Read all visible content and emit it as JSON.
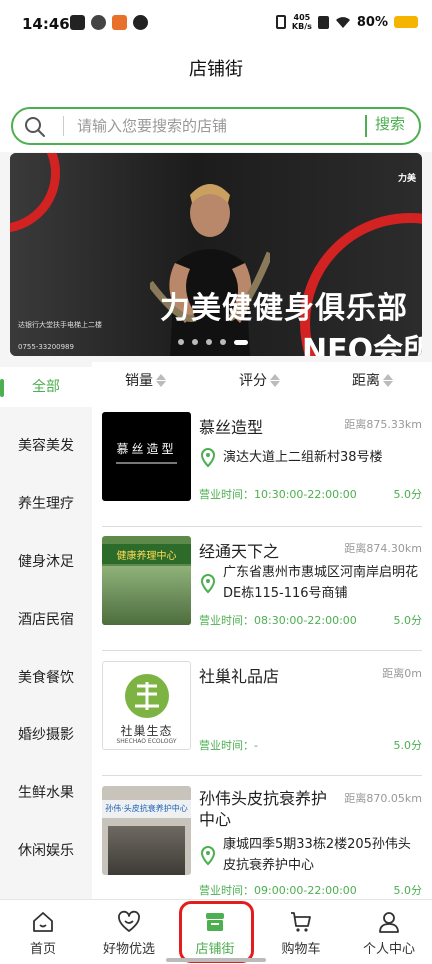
{
  "status_bar": {
    "time": "14:46",
    "speed_value": "405",
    "speed_unit": "KB/s",
    "battery": "80%"
  },
  "header": {
    "title": "店铺街"
  },
  "search": {
    "placeholder": "请输入您要搜索的店铺",
    "button_label": "搜索"
  },
  "banner": {
    "logo_text": "力美",
    "headline": "力美健健身俱乐部",
    "subline": "NEO会所",
    "address": "达银行大堂扶手电梯上二楼",
    "phone": "0755-33200989",
    "slide_count": 5,
    "active_slide": 4
  },
  "categories": {
    "items": [
      "全部",
      "美容美发",
      "养生理疗",
      "健身沐足",
      "酒店民宿",
      "美食餐饮",
      "婚纱摄影",
      "生鲜水果",
      "休闲娱乐"
    ],
    "active_index": 0
  },
  "sort": {
    "items": [
      "销量",
      "评分",
      "距离"
    ]
  },
  "stores": [
    {
      "name": "慕丝造型",
      "distance": "距离875.33km",
      "address": "演达大道上二组新村38号楼",
      "hours": "营业时间：10:30:00-22:00:00",
      "score": "5.0分",
      "thumb_text": "慕丝造型"
    },
    {
      "name": "经通天下之",
      "distance": "距离874.30km",
      "address": "广东省惠州市惠城区河南岸启明花DE栋115-116号商铺",
      "hours": "营业时间：08:30:00-22:00:00",
      "score": "5.0分",
      "thumb_text": "健康养理中心"
    },
    {
      "name": "社巢礼品店",
      "distance": "距离0m",
      "address": "",
      "hours": "营业时间：-",
      "score": "5.0分",
      "thumb_text": "社巢生态",
      "thumb_sub": "SHECHAO ECOLOGY"
    },
    {
      "name": "孙伟头皮抗衰养护中心",
      "distance": "距离870.05km",
      "address": "康城四季5期33栋2楼205孙伟头皮抗衰养护中心",
      "hours": "营业时间：09:00:00-22:00:00",
      "score": "5.0分",
      "thumb_text": "孙伟·头皮抗衰养护中心"
    }
  ],
  "bottom_nav": {
    "items": [
      {
        "label": "首页",
        "icon": "home-icon"
      },
      {
        "label": "好物优选",
        "icon": "heart-smile-icon"
      },
      {
        "label": "店铺街",
        "icon": "store-icon"
      },
      {
        "label": "购物车",
        "icon": "cart-icon"
      },
      {
        "label": "个人中心",
        "icon": "user-icon"
      }
    ],
    "active_index": 2
  },
  "colors": {
    "accent": "#4caf50",
    "highlight": "#e31d1d",
    "banner_red": "#d32222"
  }
}
